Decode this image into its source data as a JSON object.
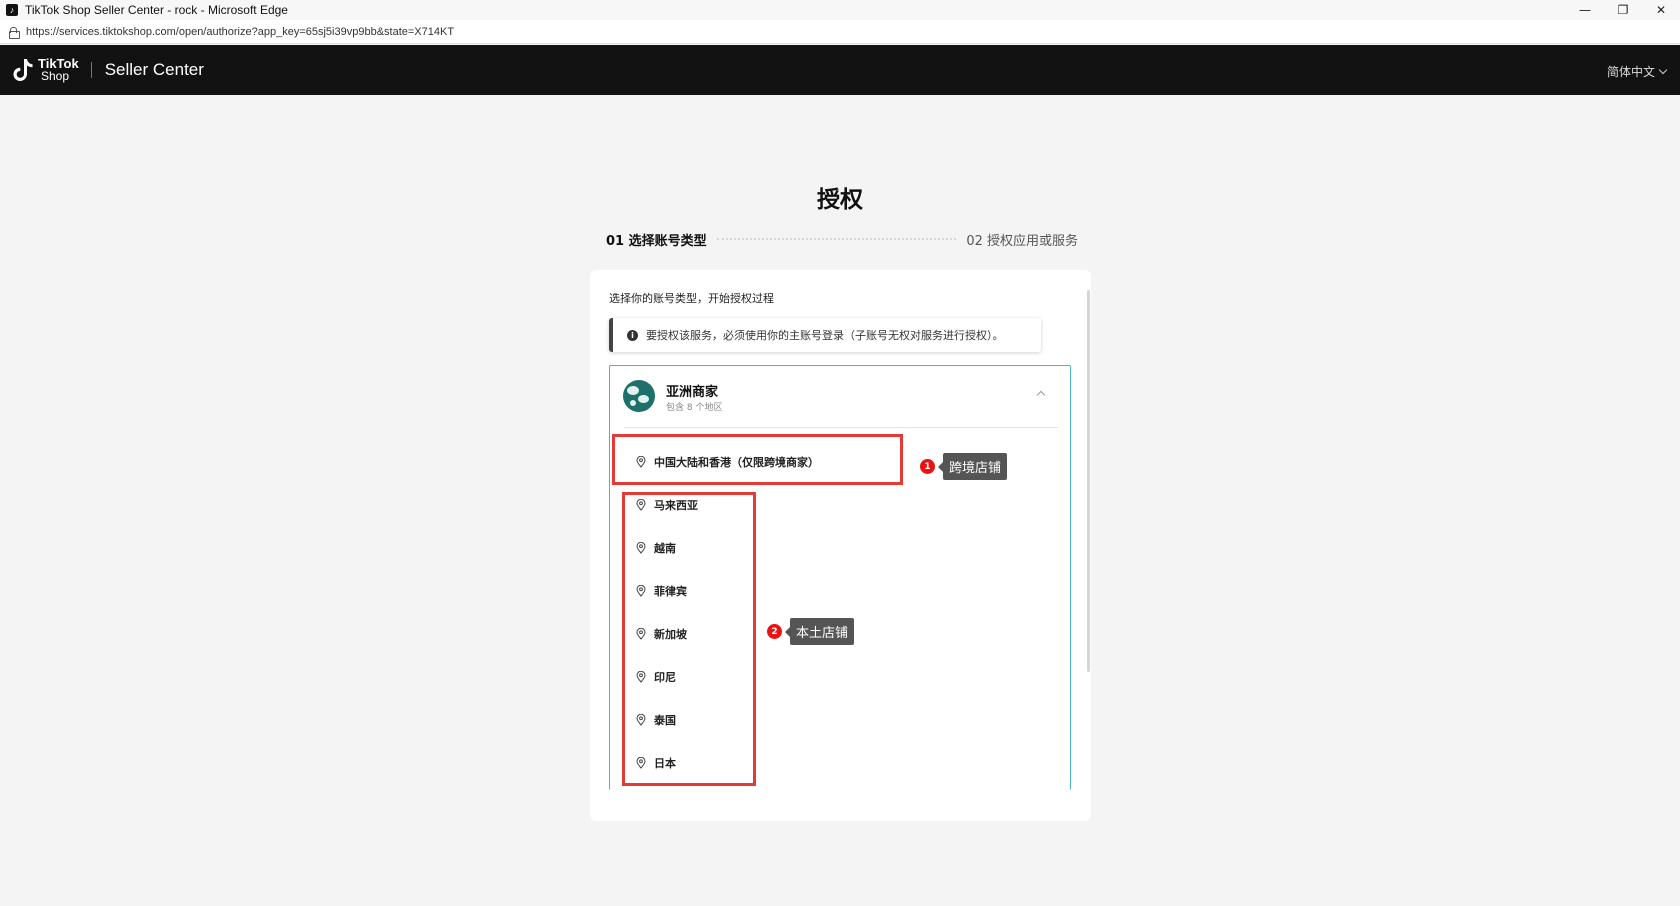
{
  "window": {
    "title": "TikTok Shop Seller Center - rock - Microsoft Edge",
    "url": "https://services.tiktokshop.com/open/authorize?app_key=65sj5i39vp9bb&state=X714KT"
  },
  "header": {
    "logo_line1": "TikTok",
    "logo_line2": "Shop",
    "app_name": "Seller Center",
    "language": "简体中文"
  },
  "page": {
    "title": "授权",
    "steps": [
      {
        "label": "01 选择账号类型",
        "active": true
      },
      {
        "label": "02 授权应用或服务",
        "active": false
      }
    ],
    "intro": "选择你的账号类型，开始授权过程",
    "alert": "要授权该服务，必须使用你的主账号登录（子账号无权对服务进行授权）。"
  },
  "region": {
    "name": "亚洲商家",
    "subtitle": "包含 8 个地区",
    "locations": [
      "中国大陆和香港（仅限跨境商家）",
      "马来西亚",
      "越南",
      "菲律宾",
      "新加坡",
      "印尼",
      "泰国",
      "日本"
    ]
  },
  "annotations": [
    {
      "badge": "1",
      "label": "跨境店铺"
    },
    {
      "badge": "2",
      "label": "本土店铺"
    }
  ],
  "colors": {
    "accent_border": "#4ab5c4",
    "annotation_red": "#e53935",
    "appbar_bg": "#121212"
  }
}
